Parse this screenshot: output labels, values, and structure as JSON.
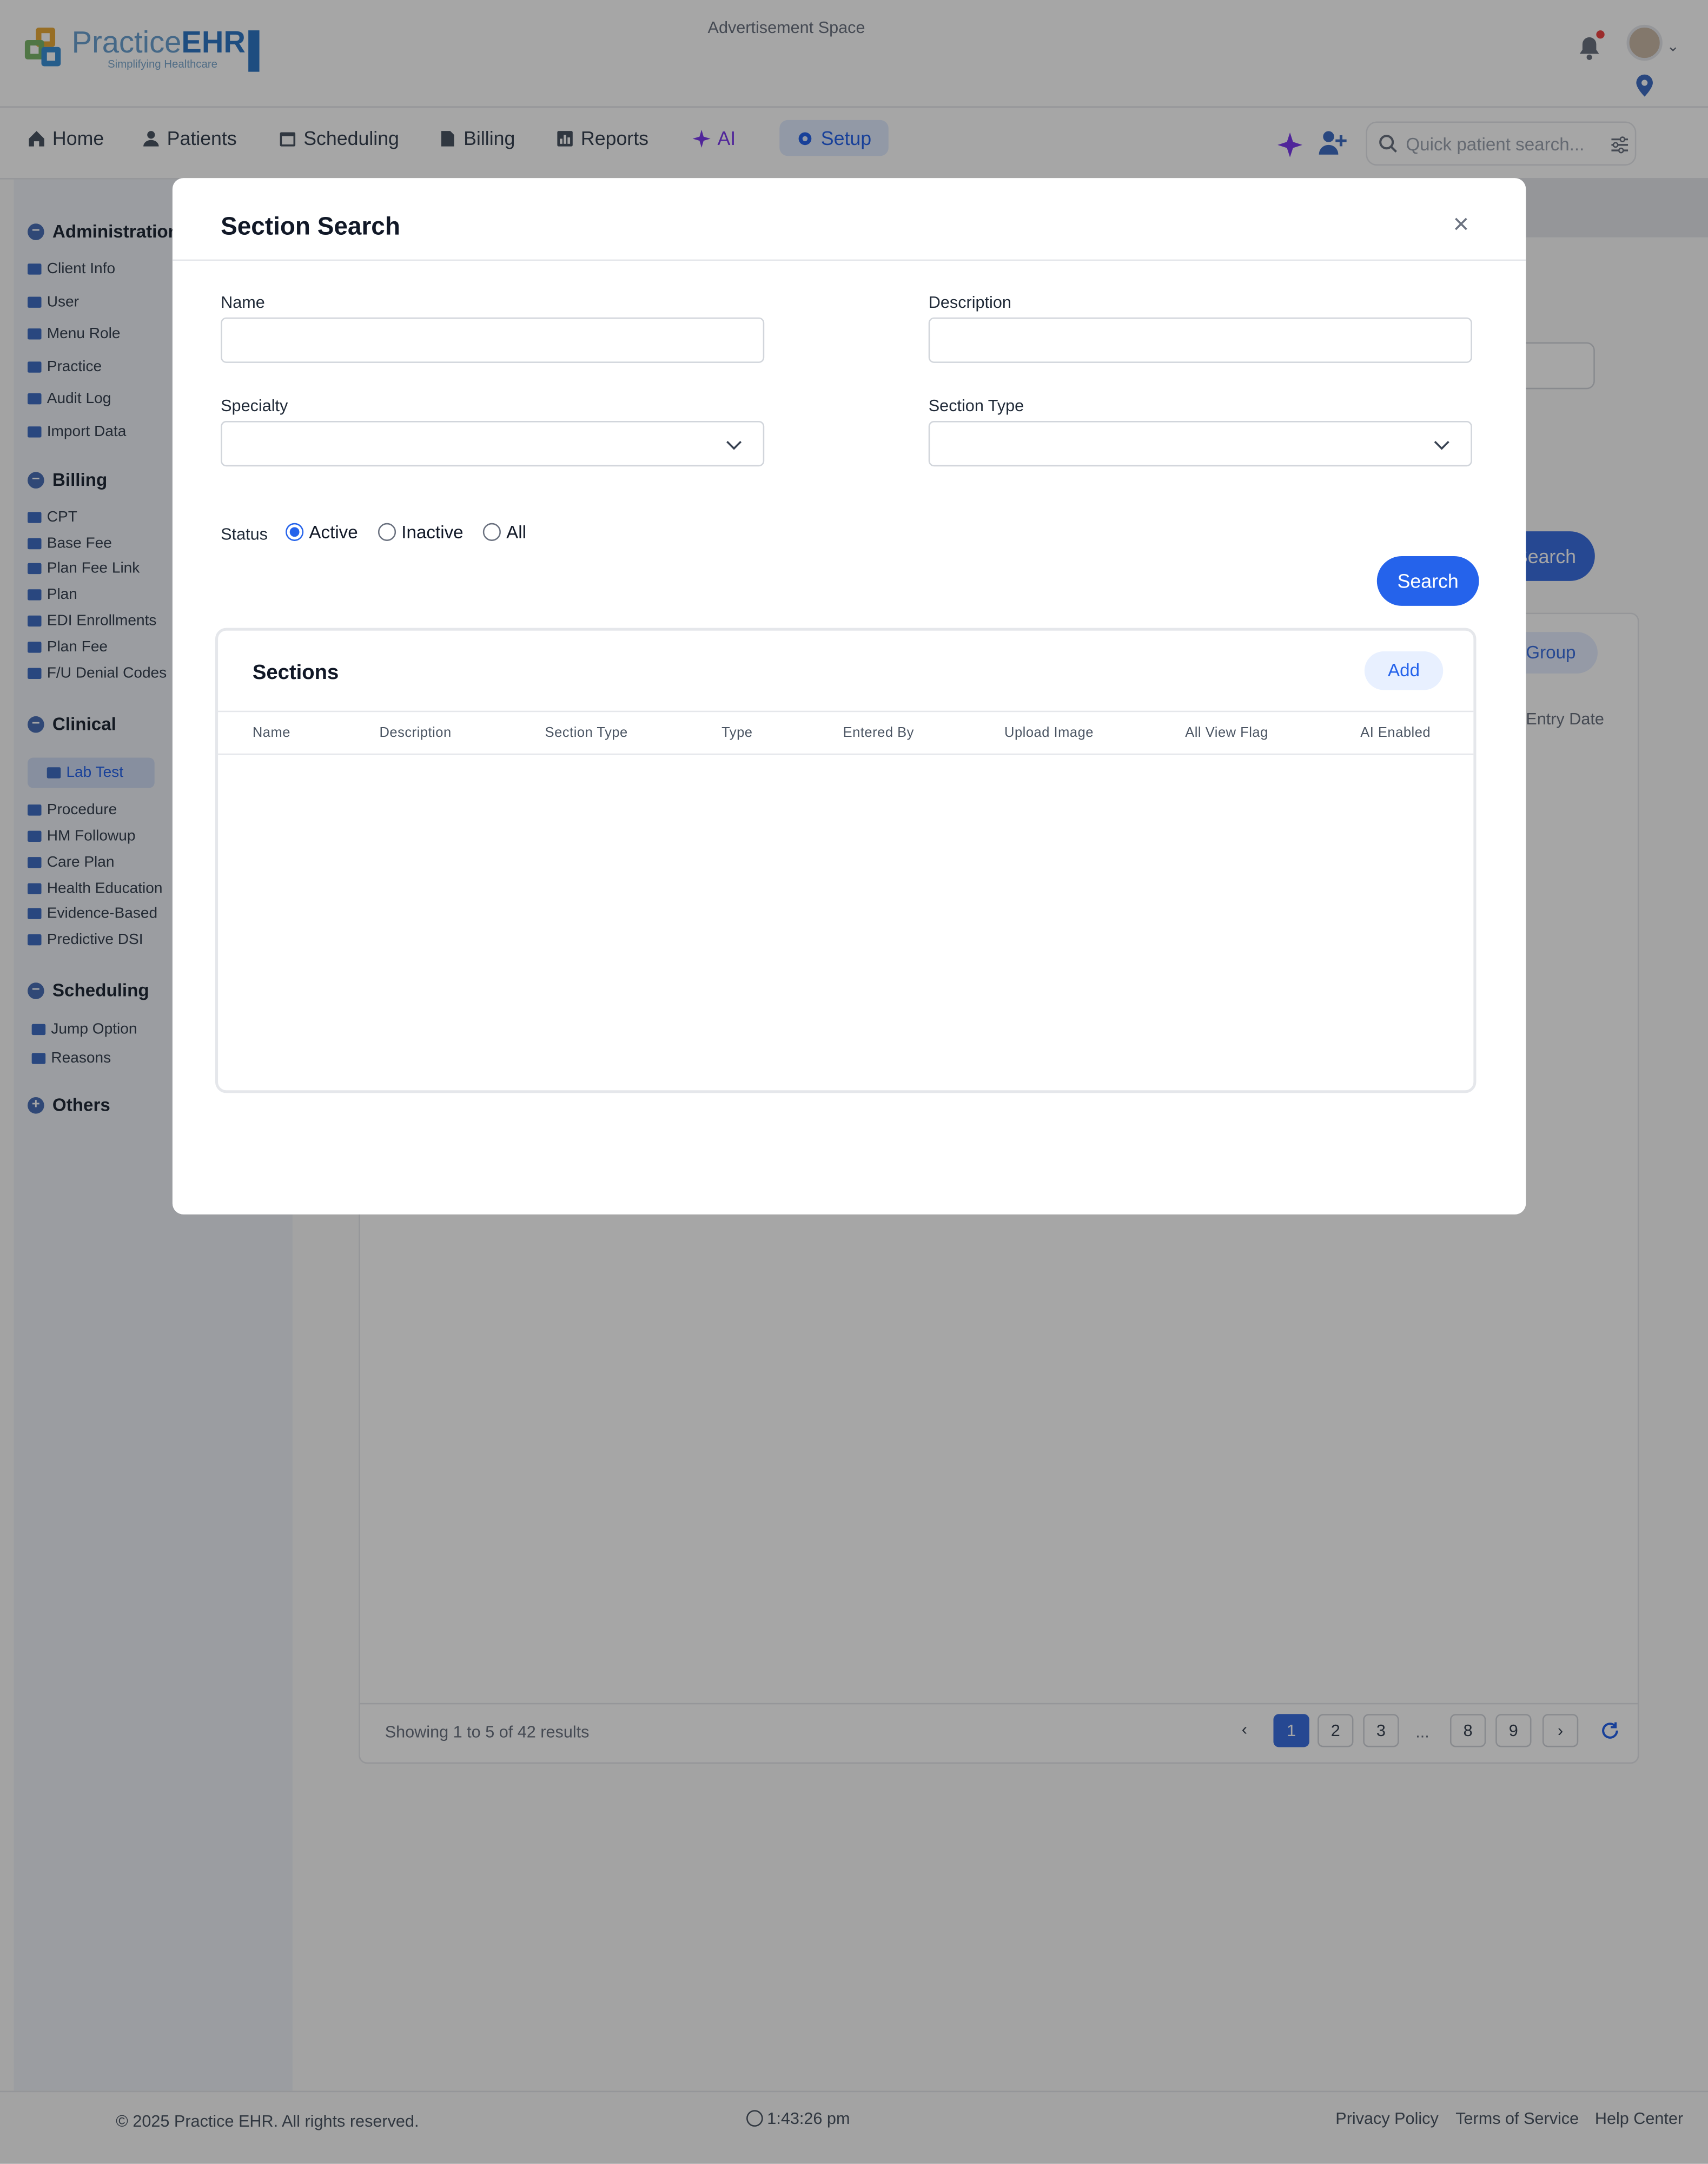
{
  "header": {
    "logo_text_1": "Practice",
    "logo_text_2": "EHR",
    "logo_tagline": "Simplifying Healthcare",
    "ad_text": "Advertisement Space"
  },
  "nav": {
    "items": [
      {
        "label": "Home",
        "icon": "home-icon"
      },
      {
        "label": "Patients",
        "icon": "patients-icon"
      },
      {
        "label": "Scheduling",
        "icon": "calendar-icon"
      },
      {
        "label": "Billing",
        "icon": "billing-icon"
      },
      {
        "label": "Reports",
        "icon": "reports-icon"
      },
      {
        "label": "AI",
        "icon": "sparkle-icon"
      },
      {
        "label": "Setup",
        "icon": "gear-icon"
      }
    ],
    "quick_search_placeholder": "Quick patient search..."
  },
  "sidebar": {
    "groups": [
      {
        "label": "Administration",
        "items": [
          "Client Info",
          "User",
          "Menu Role",
          "Practice",
          "Audit Log",
          "Import Data"
        ]
      },
      {
        "label": "Billing",
        "items": [
          "CPT",
          "Base Fee",
          "Plan Fee Link",
          "Plan",
          "EDI Enrollments",
          "Plan Fee",
          "F/U Denial Codes"
        ]
      },
      {
        "label": "Clinical",
        "items": [
          "Lab Test",
          "Procedure",
          "HM Followup",
          "Care Plan",
          "Health Education",
          "Evidence-Based",
          "Predictive DSI"
        ]
      },
      {
        "label": "Scheduling",
        "items": [
          "Jump Option",
          "Reasons"
        ]
      },
      {
        "label": "Others",
        "items": []
      }
    ],
    "active_item": "Lab Test"
  },
  "background": {
    "search_label": "Search",
    "group_label": "Group",
    "entry_date_label": "Entry Date",
    "showing_text": "Showing 1 to 5 of 42 results",
    "pages": [
      "1",
      "2",
      "3",
      "8",
      "9"
    ],
    "ellipsis": "...",
    "active_page": "1"
  },
  "footer": {
    "copyright": "© 2025 Practice EHR. All rights reserved.",
    "time": "1:43:26 pm",
    "links": [
      "Privacy Policy",
      "Terms of Service",
      "Help Center"
    ]
  },
  "modal": {
    "title": "Section Search",
    "fields": {
      "name_label": "Name",
      "name_value": "",
      "description_label": "Description",
      "description_value": "",
      "specialty_label": "Specialty",
      "specialty_value": "",
      "section_type_label": "Section Type",
      "section_type_value": ""
    },
    "status": {
      "label": "Status",
      "options": [
        "Active",
        "Inactive",
        "All"
      ],
      "selected": "Active"
    },
    "search_button": "Search",
    "sections": {
      "title": "Sections",
      "add_button": "Add",
      "columns": [
        "Name",
        "Description",
        "Section Type",
        "Type",
        "Entered By",
        "Upload Image",
        "All View Flag",
        "AI Enabled"
      ],
      "rows": []
    }
  },
  "colors": {
    "primary": "#2563eb",
    "overlay": "rgba(0,0,0,0.35)"
  }
}
